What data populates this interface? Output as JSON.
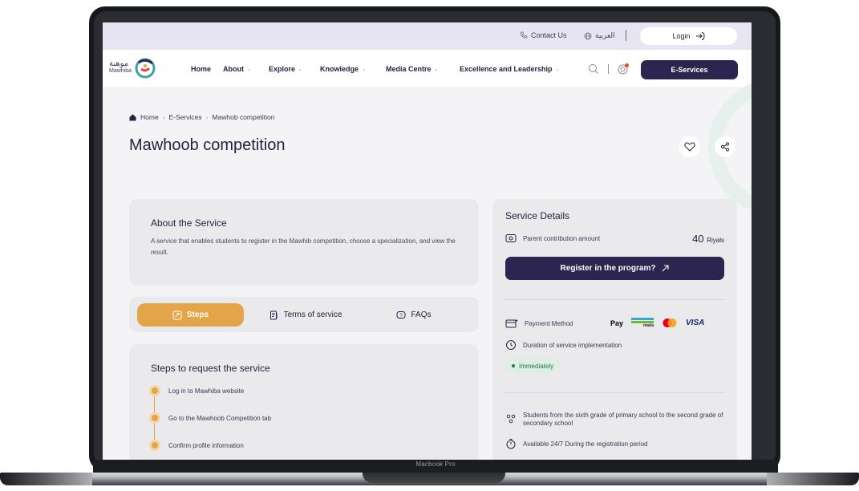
{
  "device": {
    "label": "Macbook Pro"
  },
  "topbar": {
    "contact": "Contact Us",
    "language": "العربية",
    "login": "Login"
  },
  "nav": {
    "logo_arabic": "موهبة",
    "logo_english": "Mawhiba",
    "links": [
      "Home",
      "About",
      "Explore",
      "Knowledge",
      "Media Centre",
      "Excellence and Leadership"
    ],
    "eservices": "E-Services"
  },
  "breadcrumb": [
    "Home",
    "E-Services",
    "Mawhob competition"
  ],
  "page_title": "Mawhoob competition",
  "about": {
    "title": "About the Service",
    "description": "A service that enables students to register in the Mawhib competition, choose a specialization, and view the result."
  },
  "tabs": [
    "Steps",
    "Terms of service",
    "FAQs"
  ],
  "steps": {
    "title": "Steps to request the service",
    "items": [
      "Log in to Mawhiba website",
      "Go to the Mawhoob Competition tab",
      "Confirm profile information"
    ]
  },
  "service_details": {
    "title": "Service Details",
    "contribution_label": "Parent contribution amount",
    "amount": "40",
    "currency": "Riyals",
    "register": "Register in the program?",
    "payment_label": "Payment Method",
    "payment_methods": [
      "Pay",
      "mada",
      "VISA"
    ],
    "duration_label": "Duration of service implementation",
    "duration_value": "Immediately",
    "eligibility": "Students from the sixth grade of primary school to the second grade of secondary school",
    "availability": "Available 24/7 During the registration period"
  },
  "colors": {
    "primary": "#2b2550",
    "accent": "#e2a54a",
    "success": "#1f7a4a"
  }
}
